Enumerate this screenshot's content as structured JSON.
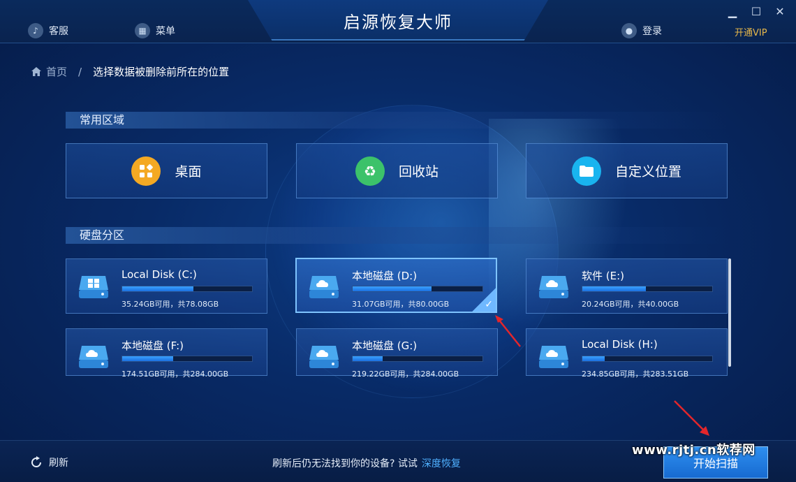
{
  "app": {
    "title": "启源恢复大师"
  },
  "topbar": {
    "service_label": "客服",
    "menu_label": "菜单",
    "login_label": "登录",
    "vip_label": "开通VIP"
  },
  "breadcrumb": {
    "home": "首页",
    "separator": "/",
    "current": "选择数据被删除前所在的位置"
  },
  "sections": {
    "common": "常用区域",
    "partitions": "硬盘分区"
  },
  "areas": [
    {
      "label": "桌面",
      "icon": "apps-icon",
      "color": "#f4a923"
    },
    {
      "label": "回收站",
      "icon": "recycle-icon",
      "color": "#3cc26a"
    },
    {
      "label": "自定义位置",
      "icon": "folder-icon",
      "color": "#19b4ef"
    }
  ],
  "disks": [
    {
      "name": "Local Disk (C:)",
      "info": "35.24GB可用，共78.08GB",
      "used_fraction": 0.55,
      "icon": "windows-disk-icon",
      "selected": false
    },
    {
      "name": "本地磁盘 (D:)",
      "info": "31.07GB可用，共80.00GB",
      "used_fraction": 0.61,
      "icon": "cloud-disk-icon",
      "selected": true
    },
    {
      "name": "软件 (E:)",
      "info": "20.24GB可用，共40.00GB",
      "used_fraction": 0.49,
      "icon": "cloud-disk-icon",
      "selected": false
    },
    {
      "name": "本地磁盘 (F:)",
      "info": "174.51GB可用，共284.00GB",
      "used_fraction": 0.39,
      "icon": "cloud-disk-icon",
      "selected": false
    },
    {
      "name": "本地磁盘 (G:)",
      "info": "219.22GB可用，共284.00GB",
      "used_fraction": 0.23,
      "icon": "cloud-disk-icon",
      "selected": false
    },
    {
      "name": "Local Disk (H:)",
      "info": "234.85GB可用，共283.51GB",
      "used_fraction": 0.17,
      "icon": "cloud-disk-icon",
      "selected": false
    }
  ],
  "bottombar": {
    "refresh_label": "刷新",
    "hint_text": "刷新后仍无法找到你的设备? 试试",
    "deep_recovery_link": "深度恢复",
    "scan_button": "开始扫描"
  },
  "watermark": "www.rjtj.cn软荐网"
}
